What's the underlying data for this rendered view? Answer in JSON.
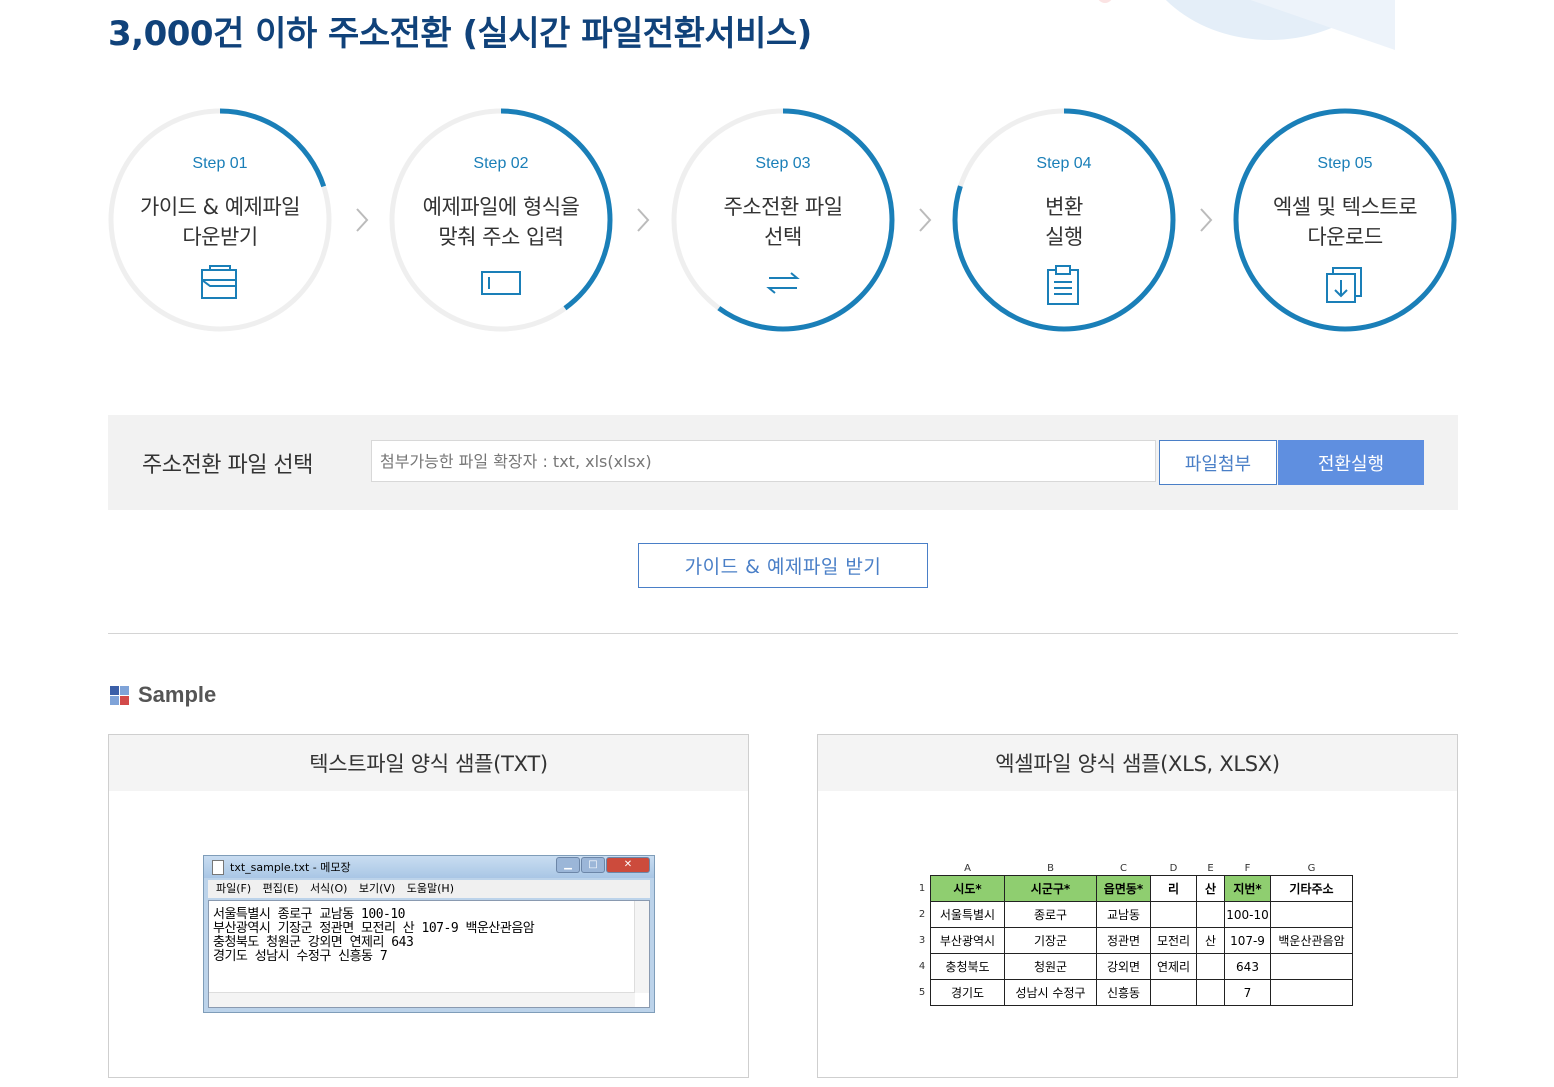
{
  "page": {
    "title": "3,000건 이하 주소전환 (실시간 파일전환서비스)"
  },
  "colors": {
    "title": "#10427a",
    "accent": "#1a7fb8",
    "button": "#5f8fe0",
    "button_border": "#4a7fc7",
    "excel_header": "#8fce70"
  },
  "steps": [
    {
      "no": "Step 01",
      "text": [
        "가이드 & 예제파일",
        "다운받기"
      ],
      "icon": "folder-icon",
      "progress": 0.2
    },
    {
      "no": "Step 02",
      "text": [
        "예제파일에 형식을",
        "맞춰 주소 입력"
      ],
      "icon": "text-input-icon",
      "progress": 0.4
    },
    {
      "no": "Step 03",
      "text": [
        "주소전환 파일",
        "선택"
      ],
      "icon": "exchange-arrows-icon",
      "progress": 0.6
    },
    {
      "no": "Step 04",
      "text": [
        "변환",
        "실행"
      ],
      "icon": "clipboard-icon",
      "progress": 0.8
    },
    {
      "no": "Step 05",
      "text": [
        "엑셀 및 텍스트로",
        "다운로드"
      ],
      "icon": "download-icon",
      "progress": 1.0
    }
  ],
  "file_select": {
    "label": "주소전환 파일 선택",
    "placeholder": "첨부가능한 파일 확장자 : txt, xls(xlsx)",
    "attach_label": "파일첨부",
    "run_label": "전환실행"
  },
  "guide_button": {
    "label": "가이드 & 예제파일 받기"
  },
  "sample": {
    "title": "Sample",
    "icon": "grid-icon",
    "txt_card": {
      "title": "텍스트파일 양식 샘플(TXT)",
      "window_title": "txt_sample.txt - 메모장",
      "menu": [
        "파일(F)",
        "편집(E)",
        "서식(O)",
        "보기(V)",
        "도움말(H)"
      ],
      "lines": [
        "서울특별시 종로구 교남동 100-10",
        "부산광역시 기장군 정관면 모전리 산 107-9 백운산관음암",
        "충청북도 청원군 강외면 연제리 643",
        "경기도 성남시 수정구 신흥동 7"
      ]
    },
    "xls_card": {
      "title": "엑셀파일 양식 샘플(XLS, XLSX)",
      "columns": [
        "A",
        "B",
        "C",
        "D",
        "E",
        "F",
        "G"
      ],
      "header": [
        "시도*",
        "시군구*",
        "읍면동*",
        "리",
        "산",
        "지번*",
        "기타주소"
      ],
      "rows": [
        {
          "n": "2",
          "cells": [
            "서울특별시",
            "종로구",
            "교남동",
            "",
            "",
            "100-10",
            ""
          ]
        },
        {
          "n": "3",
          "cells": [
            "부산광역시",
            "기장군",
            "정관면",
            "모전리",
            "산",
            "107-9",
            "백운산관음암"
          ]
        },
        {
          "n": "4",
          "cells": [
            "충청북도",
            "청원군",
            "강외면",
            "연제리",
            "",
            "643",
            ""
          ]
        },
        {
          "n": "5",
          "cells": [
            "경기도",
            "성남시 수정구",
            "신흥동",
            "",
            "",
            "7",
            ""
          ]
        }
      ]
    }
  }
}
